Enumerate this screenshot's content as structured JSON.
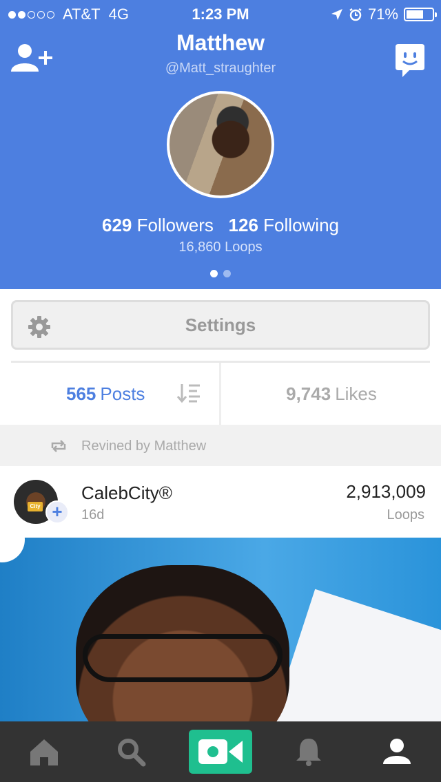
{
  "status_bar": {
    "carrier": "AT&T",
    "network": "4G",
    "time": "1:23 PM",
    "battery": "71%",
    "battery_level": 0.71
  },
  "profile": {
    "name": "Matthew",
    "handle": "@Matt_straughter",
    "followers_count": "629",
    "followers_label": "Followers",
    "following_count": "126",
    "following_label": "Following",
    "loops": "16,860 Loops"
  },
  "settings": {
    "label": "Settings"
  },
  "tabs": {
    "posts_count": "565",
    "posts_label": "Posts",
    "likes_count": "9,743",
    "likes_label": "Likes"
  },
  "revine": {
    "text": "Revined by Matthew"
  },
  "post": {
    "username": "CalebCity®",
    "age": "16d",
    "loops_count": "2,913,009",
    "loops_label": "Loops",
    "avatar_tag": "City"
  },
  "icons": {
    "add_user": "add-user-icon",
    "chat": "chat-icon",
    "gear": "gear-icon",
    "sort": "sort-icon",
    "revine": "revine-icon",
    "home": "home-icon",
    "search": "search-icon",
    "camera": "camera-icon",
    "notifications": "bell-icon",
    "profile": "profile-icon"
  },
  "colors": {
    "header": "#4d7fe0",
    "accent": "#4d7fe0",
    "camera": "#1fbf8f",
    "tabbar": "#333333"
  }
}
